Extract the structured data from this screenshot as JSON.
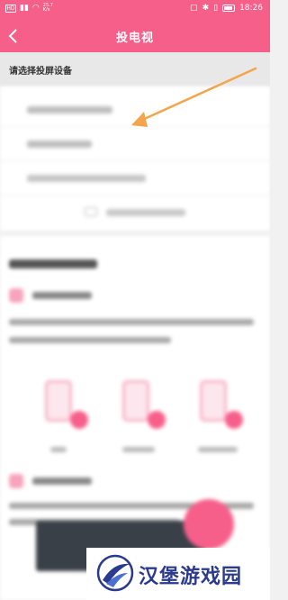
{
  "status_bar": {
    "signal_badge": "HD",
    "speed_value": "25.7",
    "speed_unit": "K/s",
    "time": "18:26"
  },
  "header": {
    "title": "投电视"
  },
  "device_section": {
    "prompt": "请选择投屏设备"
  },
  "watermark": {
    "text": "汉堡游戏园"
  },
  "colors": {
    "accent": "#f75f8b",
    "arrow": "#f2a54c",
    "watermark_blue": "#2a3a8f"
  },
  "icons": {
    "back": "chevron-left-icon",
    "arrow": "orange-arrow-annotation",
    "logo": "watermark-logo-icon"
  }
}
